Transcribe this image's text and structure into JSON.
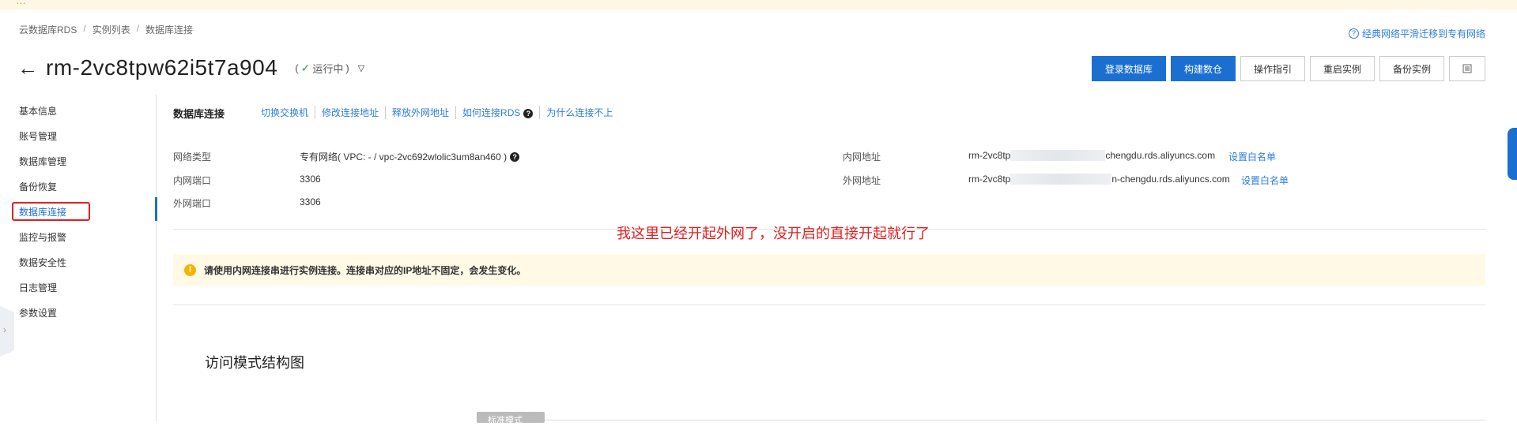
{
  "banner": {
    "text": "…"
  },
  "breadcrumb": [
    "云数据库RDS",
    "实例列表",
    "数据库连接"
  ],
  "breadcrumb_sep": "/",
  "migrate_link": "经典网络平滑迁移到专有网络",
  "instance": {
    "id": "rm-2vc8tpw62i5t7a904",
    "status": "运行中"
  },
  "actions": {
    "login": "登录数据库",
    "build": "构建数仓",
    "guide": "操作指引",
    "restart": "重启实例",
    "backup": "备份实例"
  },
  "sidebar": [
    "基本信息",
    "账号管理",
    "数据库管理",
    "备份恢复",
    "数据库连接",
    "监控与报警",
    "数据安全性",
    "日志管理",
    "参数设置"
  ],
  "section": {
    "title": "数据库连接",
    "links": [
      "切换交换机",
      "修改连接地址",
      "释放外网地址",
      "如何连接RDS",
      "为什么连接不上"
    ]
  },
  "conn": {
    "network_type_label": "网络类型",
    "network_type_value": "专有网络( VPC: - / vpc-2vc692wlolic3um8an460 )",
    "intranet_port_label": "内网端口",
    "intranet_port_value": "3306",
    "internet_port_label": "外网端口",
    "internet_port_value": "3306",
    "intranet_addr_label": "内网地址",
    "intranet_addr_prefix": "rm-2vc8tp",
    "intranet_addr_suffix": "chengdu.rds.aliyuncs.com",
    "internet_addr_label": "外网地址",
    "internet_addr_prefix": "rm-2vc8tp",
    "internet_addr_suffix": "n-chengdu.rds.aliyuncs.com",
    "whitelist": "设置白名单"
  },
  "annotation": "我这里已经开起外网了，没开启的直接开起就行了",
  "notice": "请使用内网连接串进行实例连接。连接串对应的IP地址不固定，会发生变化。",
  "arch_title": "访问模式结构图",
  "std_mode": "标准模式",
  "colors": {
    "primary": "#1a6fd1",
    "link": "#2d7de0",
    "annotation": "#e02020",
    "notice_bg": "#fff9e6"
  }
}
